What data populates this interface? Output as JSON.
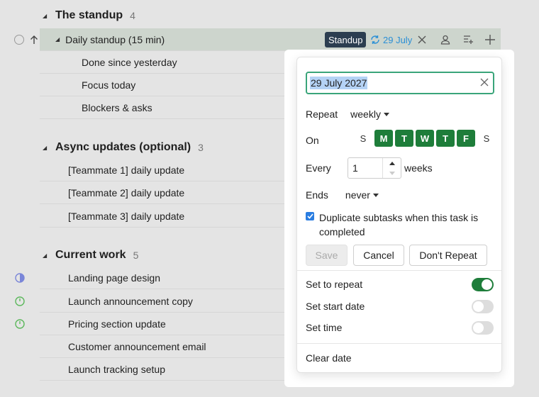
{
  "groups": [
    {
      "title": "The standup",
      "count": "4"
    },
    {
      "title": "Async updates (optional)",
      "count": "3"
    },
    {
      "title": "Current work",
      "count": "5"
    }
  ],
  "selected_task": {
    "title": "Daily standup (15 min)",
    "tag": "Standup",
    "date": "29 July"
  },
  "standup_subtasks": [
    "Done since yesterday",
    "Focus today",
    "Blockers & asks"
  ],
  "async_tasks": [
    "[Teammate 1] daily update",
    "[Teammate 2] daily update",
    "[Teammate 3] daily update"
  ],
  "current_tasks": [
    "Landing page design",
    "Launch announcement copy",
    "Pricing section update",
    "Customer announcement email",
    "Launch tracking setup"
  ],
  "popup": {
    "date_value": "29 July 2027",
    "repeat_label": "Repeat",
    "repeat_value": "weekly",
    "on_label": "On",
    "days": [
      {
        "letter": "S",
        "active": false
      },
      {
        "letter": "M",
        "active": true
      },
      {
        "letter": "T",
        "active": true
      },
      {
        "letter": "W",
        "active": true
      },
      {
        "letter": "T",
        "active": true
      },
      {
        "letter": "F",
        "active": true
      },
      {
        "letter": "S",
        "active": false
      }
    ],
    "every_label": "Every",
    "every_value": "1",
    "every_unit": "weeks",
    "ends_label": "Ends",
    "ends_value": "never",
    "duplicate_checked": true,
    "duplicate_text_1": "Duplicate subtasks when this task is",
    "duplicate_text_2": "completed",
    "save_label": "Save",
    "cancel_label": "Cancel",
    "dont_repeat_label": "Don't Repeat",
    "set_repeat_label": "Set to repeat",
    "set_repeat_on": true,
    "set_start_label": "Set start date",
    "set_start_on": false,
    "set_time_label": "Set time",
    "set_time_on": false,
    "clear_date_label": "Clear date"
  },
  "colors": {
    "accent_green": "#1e7d3a",
    "date_blue": "#2a8fd6",
    "tag_dark": "#2c3e50"
  }
}
